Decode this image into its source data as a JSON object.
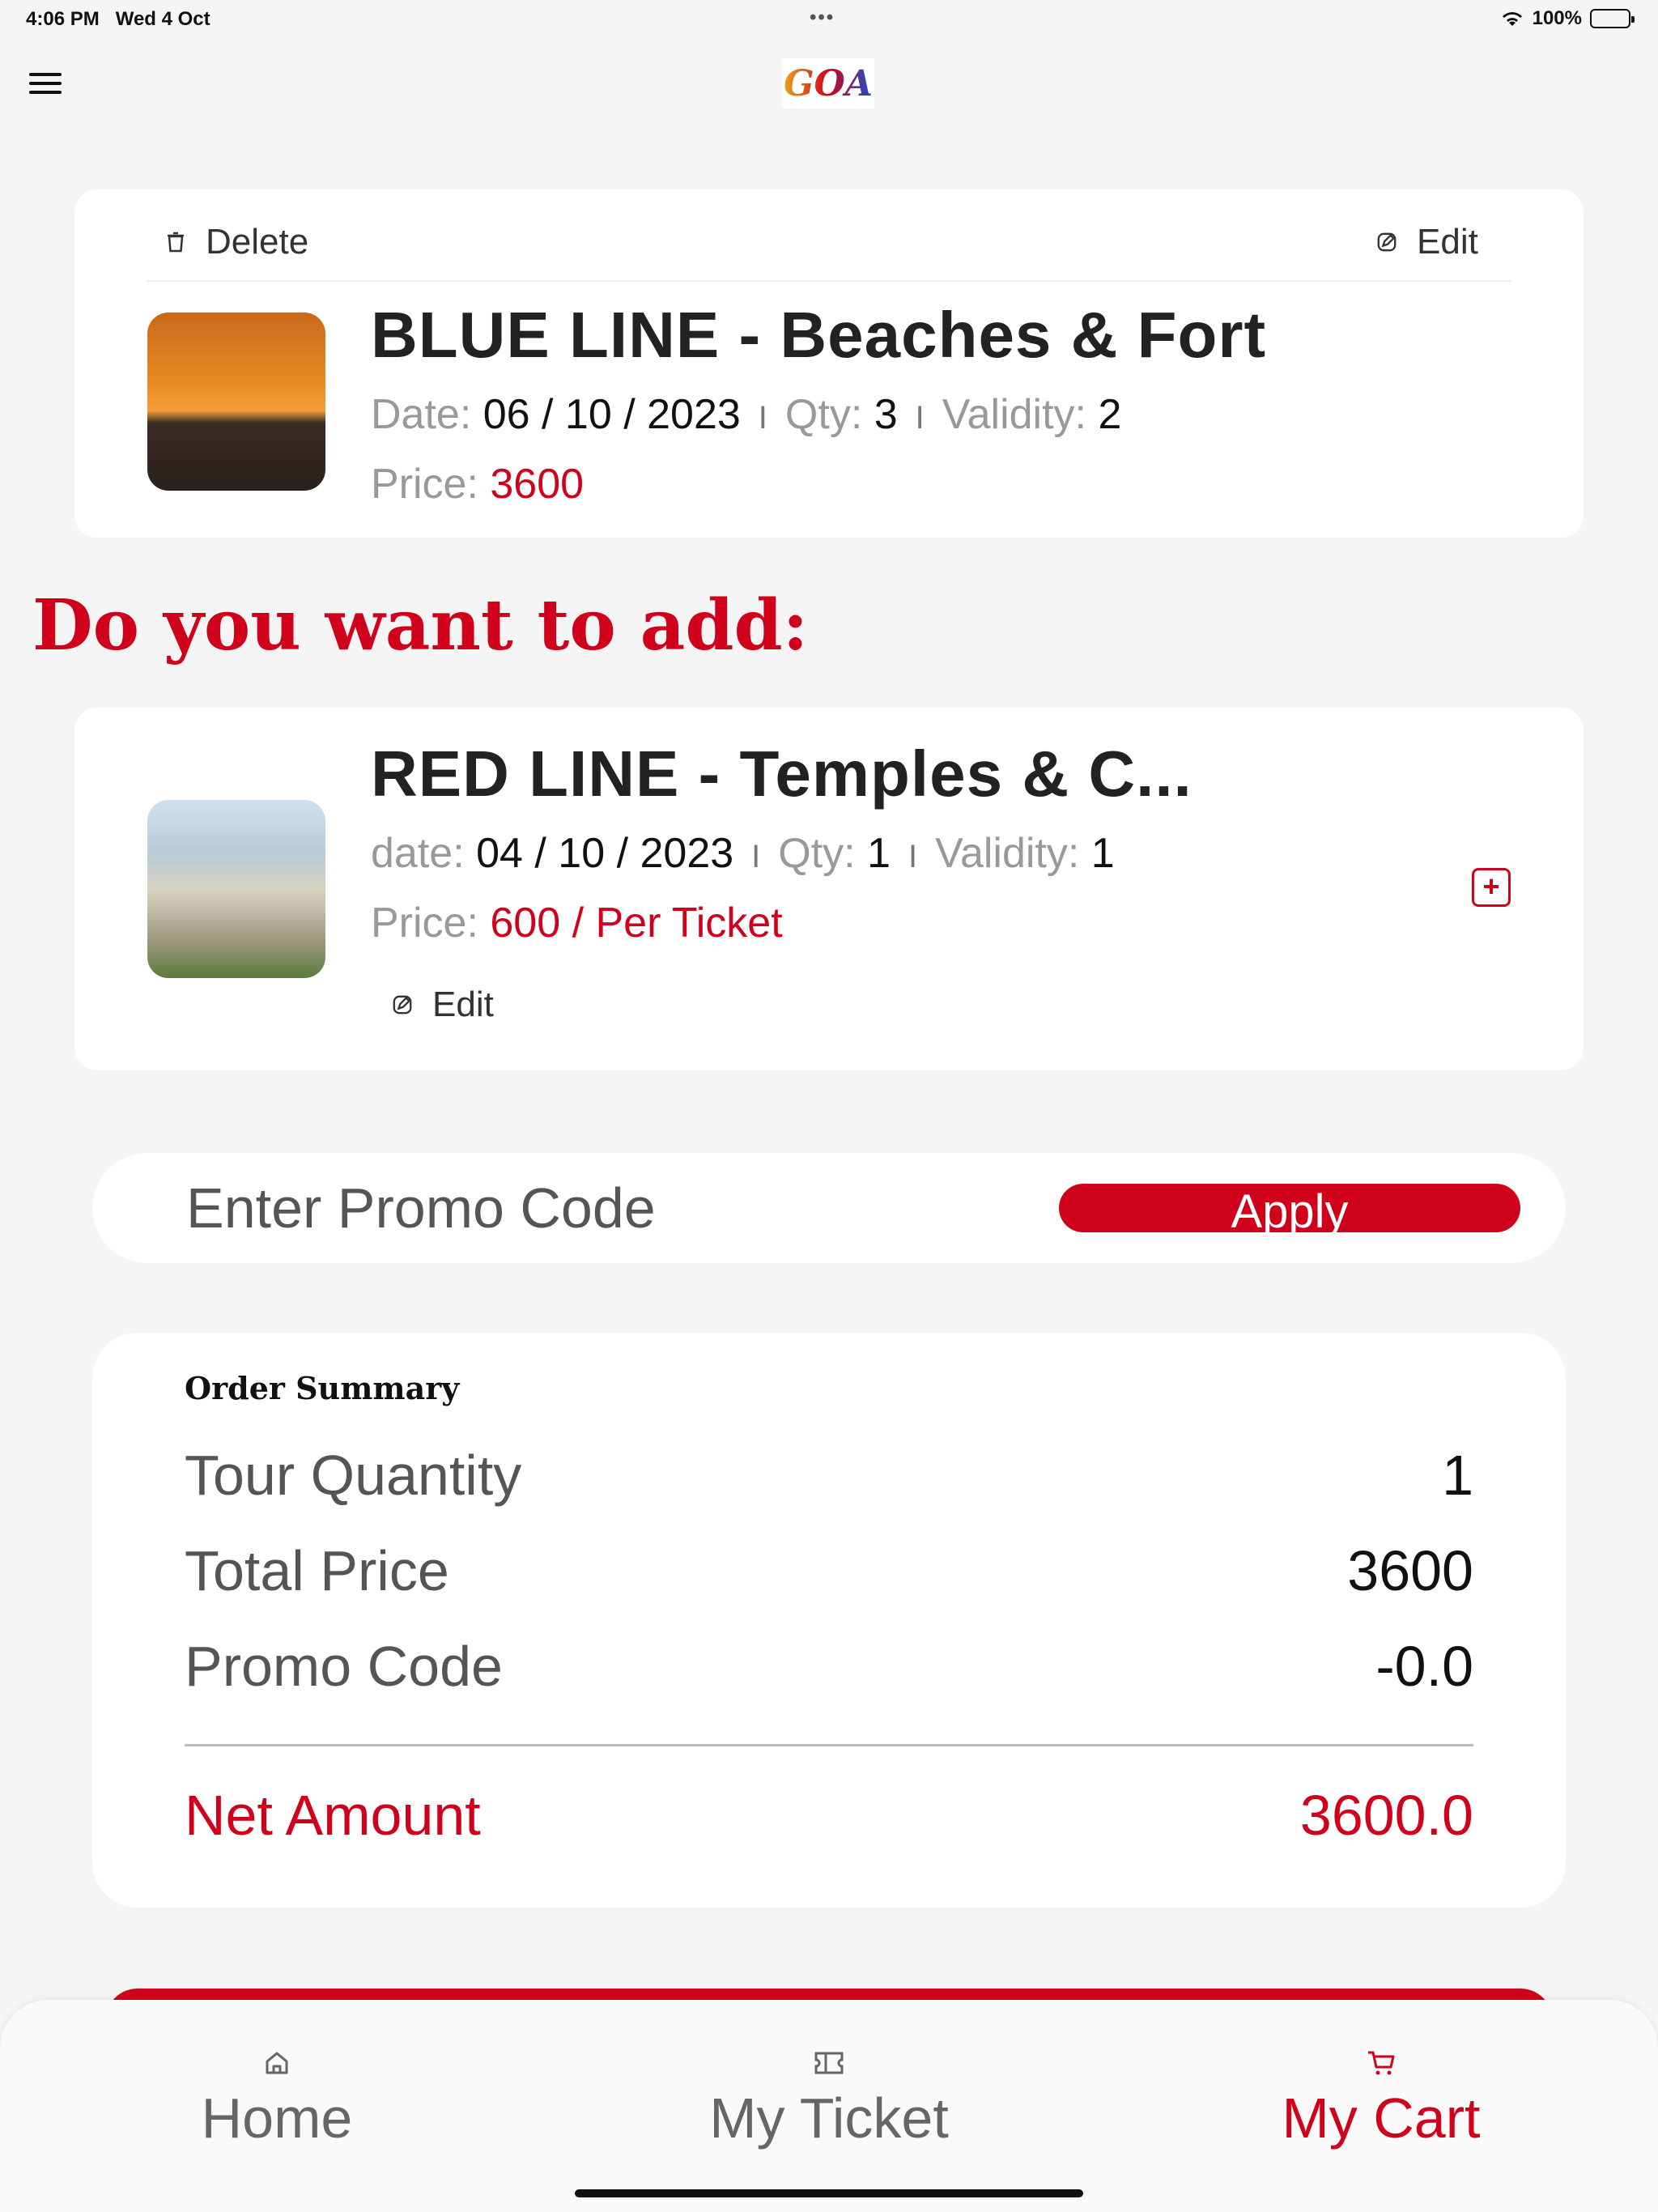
{
  "status_bar": {
    "time": "4:06 PM",
    "date": "Wed 4 Oct",
    "dots": "•••",
    "battery": "100%"
  },
  "header": {
    "logo_text": "GOA"
  },
  "cart_item": {
    "delete_label": "Delete",
    "edit_label": "Edit",
    "title": "BLUE LINE - Beaches & Fort",
    "date_label": "Date:",
    "date_value": "06 / 10 / 2023",
    "qty_label": "Qty:",
    "qty_value": "3",
    "validity_label": "Validity:",
    "validity_value": "2",
    "price_label": "Price:",
    "price_value": "3600",
    "sep": "I"
  },
  "suggest": {
    "heading": "Do you want to add:",
    "title": "RED LINE - Temples & C...",
    "date_label": "date:",
    "date_value": "04 / 10 / 2023",
    "qty_label": "Qty:",
    "qty_value": "1",
    "validity_label": "Validity:",
    "validity_value": "1",
    "price_label": "Price:",
    "price_value": "600 / Per Ticket",
    "edit_label": "Edit",
    "add_symbol": "+",
    "sep": "I"
  },
  "promo": {
    "placeholder": "Enter Promo Code",
    "value": "",
    "apply_label": "Apply"
  },
  "summary": {
    "title": "Order Summary",
    "rows": [
      {
        "label": "Tour Quantity",
        "value": "1"
      },
      {
        "label": "Total Price",
        "value": "3600"
      },
      {
        "label": "Promo Code",
        "value": "-0.0"
      }
    ],
    "net_label": "Net Amount",
    "net_value": "3600.0"
  },
  "tabs": [
    {
      "label": "Home",
      "icon": "home-icon"
    },
    {
      "label": "My Ticket",
      "icon": "ticket-icon"
    },
    {
      "label": "My Cart",
      "icon": "cart-icon",
      "active": true
    }
  ],
  "colors": {
    "accent": "#d0021b",
    "background": "#f5f5f5",
    "card": "#ffffff"
  }
}
